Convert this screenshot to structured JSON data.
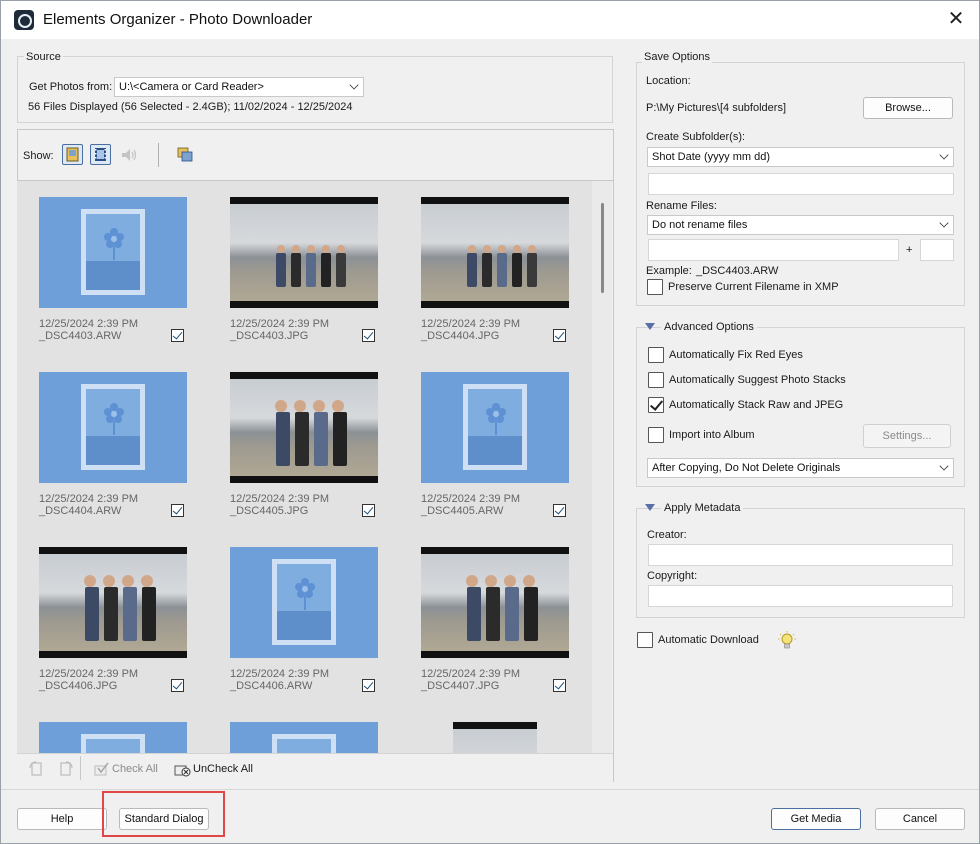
{
  "window": {
    "title": "Elements Organizer - Photo Downloader",
    "close_label": "✕"
  },
  "source": {
    "group_label": "Source",
    "get_from_label": "Get Photos from:",
    "get_from_value": "U:\\<Camera or Card Reader>",
    "summary": "56 Files Displayed (56 Selected - 2.4GB); 11/02/2024 - 12/25/2024"
  },
  "show_bar": {
    "label": "Show:",
    "icons": [
      "photo-filter-icon",
      "video-filter-icon",
      "audio-filter-icon",
      "stack-view-icon"
    ]
  },
  "thumbnails": [
    {
      "date": "12/25/2024 2:39 PM",
      "name": "_DSC4403.ARW",
      "kind": "placeholder",
      "checked": true
    },
    {
      "date": "12/25/2024 2:39 PM",
      "name": "_DSC4403.JPG",
      "kind": "photo-wide",
      "checked": true
    },
    {
      "date": "12/25/2024 2:39 PM",
      "name": "_DSC4404.JPG",
      "kind": "photo-wide",
      "checked": true
    },
    {
      "date": "12/25/2024 2:39 PM",
      "name": "_DSC4404.ARW",
      "kind": "placeholder",
      "checked": true
    },
    {
      "date": "12/25/2024 2:39 PM",
      "name": "_DSC4405.JPG",
      "kind": "photo-close",
      "checked": true
    },
    {
      "date": "12/25/2024 2:39 PM",
      "name": "_DSC4405.ARW",
      "kind": "placeholder",
      "checked": true
    },
    {
      "date": "12/25/2024 2:39 PM",
      "name": "_DSC4406.JPG",
      "kind": "photo-close",
      "checked": true
    },
    {
      "date": "12/25/2024 2:39 PM",
      "name": "_DSC4406.ARW",
      "kind": "placeholder",
      "checked": true
    },
    {
      "date": "12/25/2024 2:39 PM",
      "name": "_DSC4407.JPG",
      "kind": "photo-close",
      "checked": true
    }
  ],
  "grid_toolbar": {
    "check_all": "Check All",
    "uncheck_all": "UnCheck All"
  },
  "save_options": {
    "group_label": "Save Options",
    "location_label": "Location:",
    "location_value": "P:\\My Pictures\\[4 subfolders]",
    "browse_label": "Browse...",
    "create_subfolder_label": "Create Subfolder(s):",
    "create_subfolder_value": "Shot Date (yyyy mm dd)",
    "rename_label": "Rename Files:",
    "rename_value": "Do not rename files",
    "plus": "+",
    "example_label": "Example:",
    "example_value": "_DSC4403.ARW",
    "preserve_label": "Preserve Current Filename in XMP"
  },
  "advanced": {
    "group_label": "Advanced Options",
    "fix_red_eyes": "Automatically Fix Red Eyes",
    "suggest_stacks": "Automatically Suggest Photo Stacks",
    "stack_raw_jpeg": "Automatically Stack Raw and JPEG",
    "import_album": "Import into Album",
    "settings_label": "Settings...",
    "after_copying_value": "After Copying, Do Not Delete Originals"
  },
  "metadata": {
    "group_label": "Apply Metadata",
    "creator_label": "Creator:",
    "copyright_label": "Copyright:"
  },
  "automatic_download": "Automatic Download",
  "footer": {
    "help": "Help",
    "standard_dialog": "Standard Dialog",
    "get_media": "Get Media",
    "cancel": "Cancel"
  },
  "colors": {
    "accent": "#4a6fa0",
    "highlight": "#e04848",
    "placeholder_blue": "#6e9fd8"
  }
}
